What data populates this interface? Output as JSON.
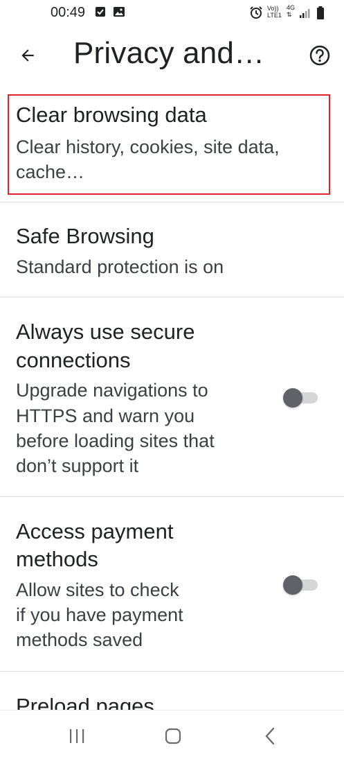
{
  "status_bar": {
    "time": "00:49",
    "network_label_top": "Vo))",
    "network_label_bottom": "LTE1",
    "data_label": "4G"
  },
  "toolbar": {
    "title": "Privacy and…"
  },
  "settings": [
    {
      "title": "Clear browsing data",
      "summary_lines": [
        "Clear history, cookies, site data,",
        "cache…"
      ]
    },
    {
      "title": "Safe Browsing",
      "summary_lines": [
        "Standard protection is on"
      ]
    },
    {
      "title_lines": [
        "Always use secure",
        "connections"
      ],
      "summary_lines": [
        "Upgrade navigations to",
        "HTTPS and warn you",
        "before loading sites that",
        "don’t support it"
      ],
      "toggle_on": false
    },
    {
      "title_lines": [
        "Access payment",
        "methods"
      ],
      "summary_lines": [
        "Allow sites to check",
        "if you have payment",
        "methods saved"
      ],
      "toggle_on": false
    },
    {
      "title": "Preload pages"
    }
  ],
  "colors": {
    "highlight": "#e0242b",
    "text_primary": "#202124",
    "text_secondary": "#3c4043",
    "toggle_thumb": "#5f6368",
    "toggle_track": "#d6d6d6"
  },
  "icons": {
    "status": [
      "checkbox-notification-icon",
      "image-notification-icon",
      "alarm-icon",
      "signal-icon",
      "battery-icon"
    ],
    "toolbar": [
      "back-arrow-icon",
      "help-icon"
    ],
    "nav": [
      "recents-icon",
      "home-icon",
      "back-nav-icon"
    ]
  }
}
